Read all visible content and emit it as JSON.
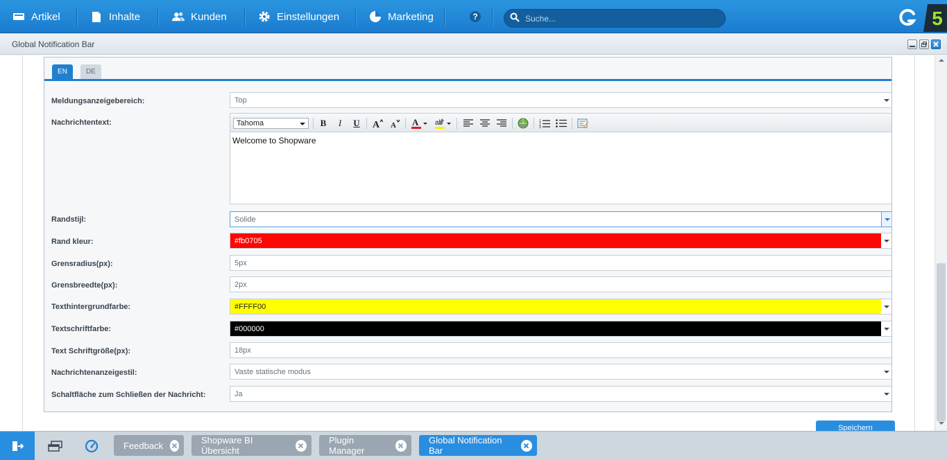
{
  "nav": {
    "items": [
      {
        "label": "Artikel",
        "icon": "monitor-icon"
      },
      {
        "label": "Inhalte",
        "icon": "document-icon"
      },
      {
        "label": "Kunden",
        "icon": "users-icon"
      },
      {
        "label": "Einstellungen",
        "icon": "gear-icon"
      },
      {
        "label": "Marketing",
        "icon": "pie-chart-icon"
      }
    ],
    "help_icon": "help-icon",
    "search_placeholder": "Suche..."
  },
  "window": {
    "title": "Global Notification Bar",
    "tabs": [
      "EN",
      "DE"
    ],
    "active_tab": "EN",
    "fields": {
      "display_area": {
        "label": "Meldungsanzeigebereich:",
        "value": "Top"
      },
      "message_text": {
        "label": "Nachrichtentext:",
        "font": "Tahoma",
        "content": "Welcome to Shopware"
      },
      "border_style": {
        "label": "Randstijl:",
        "value": "Solide"
      },
      "border_color": {
        "label": "Rand kleur:",
        "value": "#fb0705",
        "color": "#fb0705"
      },
      "border_radius": {
        "label": "Grensradius(px):",
        "value": "5px"
      },
      "border_width": {
        "label": "Grensbreedte(px):",
        "value": "2px"
      },
      "text_bg_color": {
        "label": "Texthintergrundfarbe:",
        "value": "#FFFF00",
        "color": "#FFFF00"
      },
      "text_color": {
        "label": "Textschriftfarbe:",
        "value": "#000000",
        "color": "#000000"
      },
      "text_size": {
        "label": "Text Schriftgröße(px):",
        "value": "18px"
      },
      "display_style": {
        "label": "Nachrichtenanzeigestil:",
        "value": "Vaste statische modus"
      },
      "close_button": {
        "label": "Schaltfläche zum Schließen der Nachricht:",
        "value": "Ja"
      }
    },
    "save_label": "Speichern"
  },
  "taskbar": {
    "tasks": [
      {
        "label": "Feedback",
        "active": false
      },
      {
        "label": "Shopware BI Übersicht",
        "active": false
      },
      {
        "label": "Plugin Manager",
        "active": false
      },
      {
        "label": "Global Notification Bar",
        "active": true
      }
    ]
  },
  "colors": {
    "accent": "#2a8ee0",
    "nav_bg": "#1b7ccf"
  }
}
